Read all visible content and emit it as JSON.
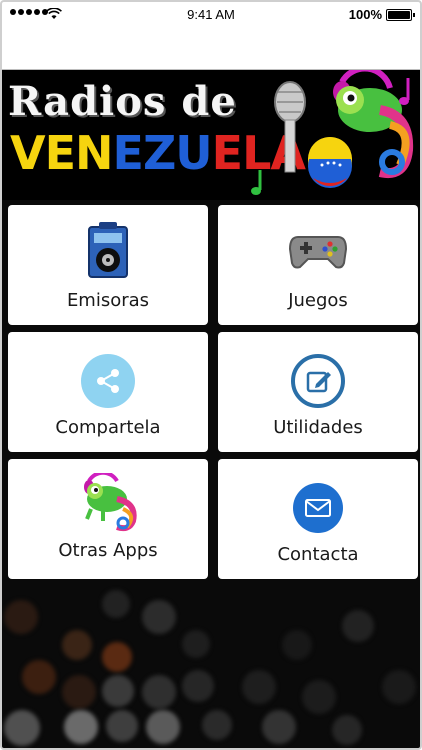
{
  "status_bar": {
    "time": "9:41 AM",
    "battery": "100%"
  },
  "banner": {
    "line1": "Radios de",
    "line2_parts": [
      "VEN",
      "EZU",
      "ELA"
    ]
  },
  "tiles": [
    {
      "label": "Emisoras",
      "icon": "radio-player-icon"
    },
    {
      "label": "Juegos",
      "icon": "gamepad-icon"
    },
    {
      "label": "Compartela",
      "icon": "share-icon"
    },
    {
      "label": "Utilidades",
      "icon": "edit-icon"
    },
    {
      "label": "Otras Apps",
      "icon": "chameleon-icon"
    },
    {
      "label": "Contacta",
      "icon": "envelope-icon"
    }
  ],
  "colors": {
    "share_bg": "#8fd3f1",
    "utilidades_ring": "#2a6fa8",
    "contact_bg": "#1e6fcf",
    "flag_yellow": "#f6d40f",
    "flag_blue": "#1f5fd6",
    "flag_red": "#e02420"
  }
}
